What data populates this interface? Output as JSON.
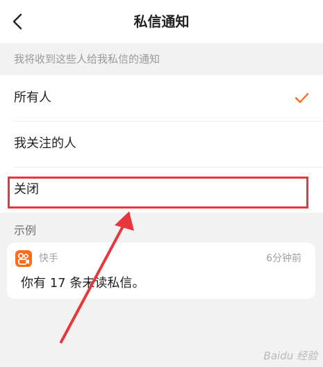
{
  "header": {
    "title": "私信通知",
    "back_icon": "chevron-left-icon"
  },
  "section": {
    "caption": "我将收到这些人给我私信的通知"
  },
  "options": [
    {
      "label": "所有人",
      "selected": true
    },
    {
      "label": "我关注的人",
      "selected": false
    },
    {
      "label": "关闭",
      "selected": false
    }
  ],
  "example": {
    "label": "示例",
    "app_name": "快手",
    "time": "6分钟前",
    "message": "你有 17 条未读私信。"
  },
  "colors": {
    "accent": "#ff6c1a",
    "highlight_box": "#e8363b",
    "page_background": "#f2f2f2"
  },
  "watermark": "Baidu 经验"
}
